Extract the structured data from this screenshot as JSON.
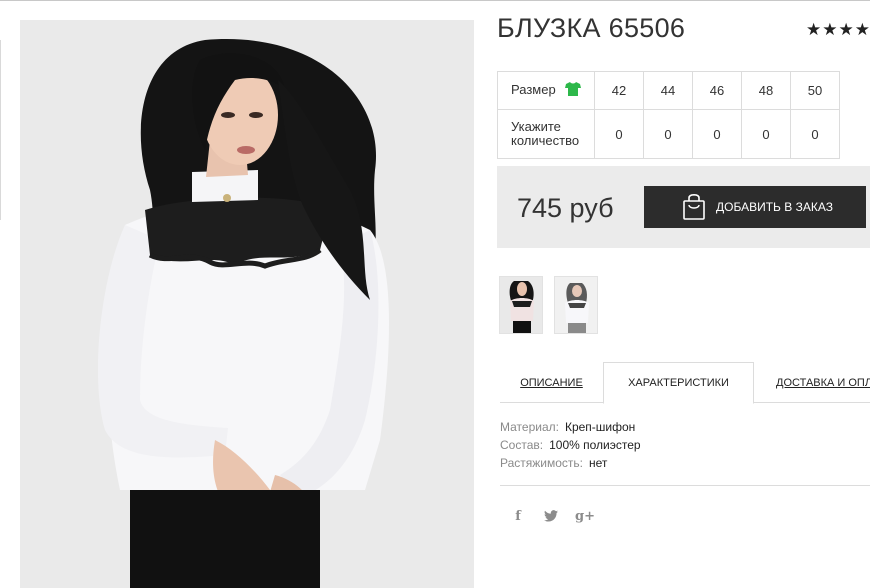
{
  "product": {
    "title": "БЛУЗКА 65506",
    "rating": "★★★★",
    "price": "745 руб",
    "order_button": "ДОБАВИТЬ В ЗАКАЗ"
  },
  "sizes": {
    "size_label": "Размер",
    "qty_label_line1": "Укажите",
    "qty_label_line2": "количество",
    "values": [
      "42",
      "44",
      "46",
      "48",
      "50"
    ],
    "quantities": [
      "0",
      "0",
      "0",
      "0",
      "0"
    ]
  },
  "tabs": {
    "description": "ОПИСАНИЕ",
    "characteristics": "ХАРАКТЕРИСТИКИ",
    "delivery": "ДОСТАВКА И ОПЛА"
  },
  "characteristics": [
    {
      "key": "Материал:",
      "value": "Креп-шифон"
    },
    {
      "key": "Состав:",
      "value": "100% полиэстер"
    },
    {
      "key": "Растяжимость:",
      "value": "нет"
    }
  ],
  "social": {
    "facebook": "f",
    "googleplus": "g+"
  },
  "colors": {
    "button_bg": "#2c2c2c",
    "price_box_bg": "#ebebeb",
    "size_icon": "#2db84a"
  }
}
